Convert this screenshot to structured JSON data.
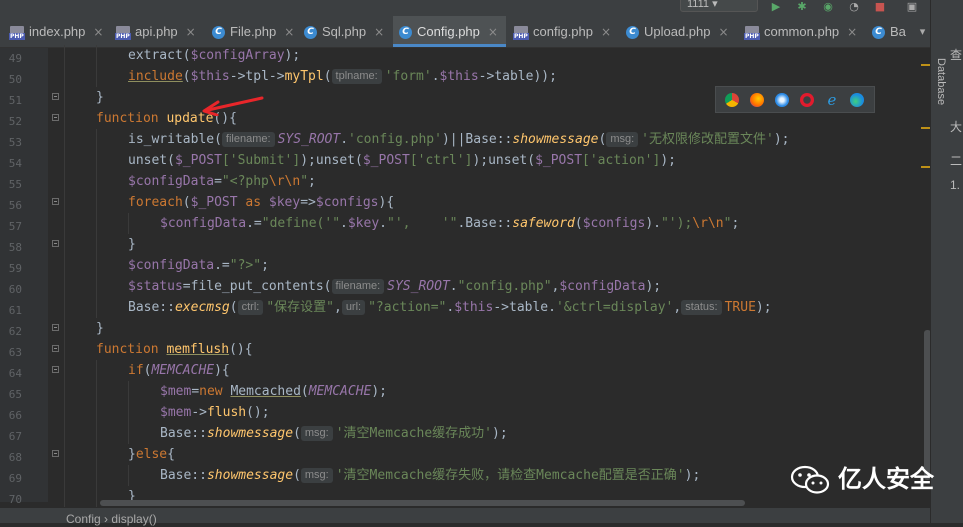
{
  "toolbar": {
    "run_config": "1111"
  },
  "tabs": [
    {
      "label": "index.php",
      "icon": "php-file-icon",
      "active": false
    },
    {
      "label": "api.php",
      "icon": "php-file-icon",
      "active": false
    },
    {
      "label": "File.php",
      "icon": "php-class-icon",
      "active": false
    },
    {
      "label": "Sql.php",
      "icon": "php-class-icon",
      "active": false
    },
    {
      "label": "Config.php",
      "icon": "php-class-icon",
      "active": true
    },
    {
      "label": "config.php",
      "icon": "php-file-icon",
      "active": false
    },
    {
      "label": "Upload.php",
      "icon": "php-class-icon",
      "active": false
    },
    {
      "label": "common.php",
      "icon": "php-file-icon",
      "active": false
    },
    {
      "label": "Ba",
      "icon": "php-class-icon",
      "active": false
    }
  ],
  "line_numbers": [
    "49",
    "50",
    "51",
    "52",
    "53",
    "54",
    "55",
    "56",
    "57",
    "58",
    "59",
    "60",
    "61",
    "62",
    "63",
    "64",
    "65",
    "66",
    "67",
    "68",
    "69",
    "70"
  ],
  "hints": {
    "tplname": "tplname:",
    "filename": "filename:",
    "msg": "msg:",
    "ctrl": "ctrl:",
    "url": "url:",
    "status": "status:"
  },
  "code": {
    "l49_extract": "extract(",
    "l49_var": "$configArray",
    "l49_end": ");",
    "l50_include": "include",
    "l50_p1": "(",
    "l50_this": "$this",
    "l50_tpl": "->tpl->",
    "l50_fn": "myTpl",
    "l50_p2": "(",
    "l50_str": "'form'",
    "l50_dot": ".",
    "l50_this2": "$this",
    "l50_table": "->table));",
    "l51": "}",
    "l52_kw": "function ",
    "l52_fn": "update",
    "l52_end": "(){",
    "l53_a": "is_writable(",
    "l53_const": "SYS_ROOT",
    "l53_dot": ".",
    "l53_str": "'config.php'",
    "l53_b": ")||Base::",
    "l53_m": "showmessage",
    "l53_c": "(",
    "l53_str2": "'无权限修改配置文件'",
    "l53_end": ");",
    "l54_a": "unset(",
    "l54_v1": "$_POST",
    "l54_s1": "['Submit']",
    "l54_b": ");unset(",
    "l54_v2": "$_POST",
    "l54_s2": "['ctrl']",
    "l54_c": ");unset(",
    "l54_v3": "$_POST",
    "l54_s3": "['action']",
    "l54_end": ");",
    "l55_v": "$configData",
    "l55_eq": "=",
    "l55_s": "\"<?php",
    "l55_esc": "\\r\\n",
    "l55_s2": "\"",
    "l55_end": ";",
    "l56_kw": "foreach",
    "l56_a": "(",
    "l56_v1": "$_POST",
    "l56_as": " as ",
    "l56_v2": "$key",
    "l56_arr": "=>",
    "l56_v3": "$configs",
    "l56_end": "){",
    "l57_v": "$configData",
    "l57_op": ".=",
    "l57_s1": "\"define('\"",
    "l57_d1": ".",
    "l57_v2": "$key",
    "l57_d2": ".",
    "l57_s2": "\"',    '\"",
    "l57_d3": ".Base::",
    "l57_m": "safeword",
    "l57_p": "(",
    "l57_v3": "$configs",
    "l57_p2": ").",
    "l57_s3": "\"');",
    "l57_esc": "\\r\\n",
    "l57_s4": "\"",
    "l57_end": ";",
    "l58": "}",
    "l59_v": "$configData",
    "l59_op": ".=",
    "l59_s": "\"?>\"",
    "l59_end": ";",
    "l60_v": "$status",
    "l60_a": "=file_put_contents(",
    "l60_const": "SYS_ROOT",
    "l60_dot": ".",
    "l60_s": "\"config.php\"",
    "l60_comma": ",",
    "l60_v2": "$configData",
    "l60_end": ");",
    "l61_a": "Base::",
    "l61_m": "execmsg",
    "l61_p": "(",
    "l61_s1": "\"保存设置\"",
    "l61_c1": ",",
    "l61_s2": "\"?action=\"",
    "l61_d": ".",
    "l61_this": "$this",
    "l61_tbl": "->table.",
    "l61_s3": "'&ctrl=display'",
    "l61_c2": ",",
    "l61_true": "TRUE",
    "l61_end": ");",
    "l62": "}",
    "l63_kw": "function ",
    "l63_fn": "memflush",
    "l63_end": "(){",
    "l64_kw": "if",
    "l64_a": "(",
    "l64_c": "MEMCACHE",
    "l64_end": "){",
    "l65_v": "$mem",
    "l65_eq": "=",
    "l65_kw": "new ",
    "l65_cls": "Memcached",
    "l65_p": "(",
    "l65_c": "MEMCACHE",
    "l65_end": ");",
    "l66_v": "$mem",
    "l66_a": "->",
    "l66_fn": "flush",
    "l66_end": "();",
    "l67_a": "Base::",
    "l67_m": "showmessage",
    "l67_p": "(",
    "l67_s": "'清空Memcache缓存成功'",
    "l67_end": ");",
    "l68_a": "}",
    "l68_kw": "else",
    "l68_end": "{",
    "l69_a": "Base::",
    "l69_m": "showmessage",
    "l69_p": "(",
    "l69_s": "'清空Memcache缓存失败，请检查Memcache配置是否正确'",
    "l69_end": ");",
    "l70": "}"
  },
  "browser_icons": [
    "chrome-icon",
    "firefox-icon",
    "safari-icon",
    "opera-icon",
    "ie-icon",
    "edge-icon"
  ],
  "right_panel": {
    "database_tab": "Database",
    "peek_1": "查",
    "peek_2": "大",
    "peek_3": "二",
    "peek_4": "1."
  },
  "breadcrumb": [
    "Config",
    "display()"
  ],
  "breadcrumb_sep": "›",
  "watermark": "亿人安全"
}
